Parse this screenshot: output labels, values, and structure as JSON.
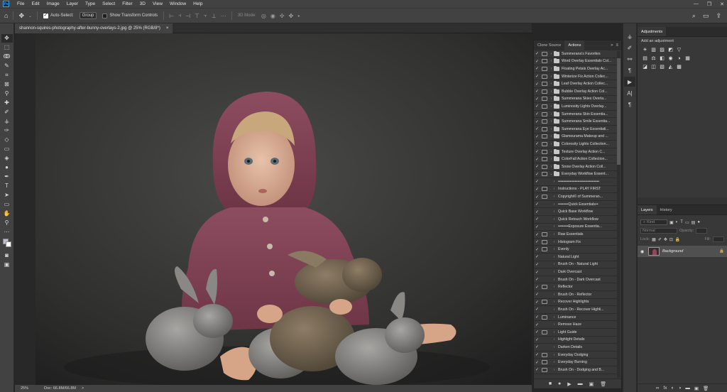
{
  "app": {
    "logo": "Ps"
  },
  "menu": [
    "File",
    "Edit",
    "Image",
    "Layer",
    "Type",
    "Select",
    "Filter",
    "3D",
    "View",
    "Window",
    "Help"
  ],
  "window_controls": {
    "minimize": "—",
    "restore": "❐",
    "close": "✕"
  },
  "options_bar": {
    "auto_select_label": "Auto-Select:",
    "auto_select_checked": true,
    "group_value": "Group",
    "show_transform_label": "Show Transform Controls",
    "mode_label": "3D Mode:"
  },
  "document": {
    "tab_title": "shannon-squires-photography-after-bunny-overlays-2.jpg @ 25% (RGB/8*)",
    "close": "×"
  },
  "status": {
    "zoom": "25%",
    "doc_info": "Doc: 66.8M/66.8M",
    "arrow": ">"
  },
  "actions_panel": {
    "tabs": [
      "Clone Source",
      "Actions"
    ],
    "active_tab": "Actions",
    "menu_icons": [
      "»",
      "≡"
    ],
    "items": [
      {
        "label": "Summerana's Favorites",
        "folder": true,
        "check": true,
        "dialog": true
      },
      {
        "label": "Word Overlay Essentials Col...",
        "folder": true,
        "check": true,
        "dialog": true
      },
      {
        "label": "Floating Petals Overlay Ac...",
        "folder": true,
        "check": true,
        "dialog": true
      },
      {
        "label": "Winterize Fix Action Collec...",
        "folder": true,
        "check": true,
        "dialog": true
      },
      {
        "label": "Leaf Overlay Action Collec...",
        "folder": true,
        "check": true,
        "dialog": true
      },
      {
        "label": "Bubble Overlay Action Col...",
        "folder": true,
        "check": true,
        "dialog": true
      },
      {
        "label": "Summerana Skies Overla...",
        "folder": true,
        "check": true,
        "dialog": true
      },
      {
        "label": "Luminosity Lights Overlay...",
        "folder": true,
        "check": true,
        "dialog": true
      },
      {
        "label": "Summerana Skin Essentia...",
        "folder": true,
        "check": true,
        "dialog": true
      },
      {
        "label": "Summerana Smile Essentia...",
        "folder": true,
        "check": true,
        "dialog": true
      },
      {
        "label": "Summerana Eye Essentiali...",
        "folder": true,
        "check": true,
        "dialog": true
      },
      {
        "label": "Glamourama Makeup and ...",
        "folder": true,
        "check": true,
        "dialog": true
      },
      {
        "label": "Colorosity Lights Collection...",
        "folder": true,
        "check": true,
        "dialog": true
      },
      {
        "label": "Texture Overlay Action C...",
        "folder": true,
        "check": true,
        "dialog": true
      },
      {
        "label": "ColorFall Action Collection...",
        "folder": true,
        "check": true,
        "dialog": true
      },
      {
        "label": "Snow Overlay Action Coll...",
        "folder": true,
        "check": true,
        "dialog": true
      },
      {
        "label": "Everyday Workflow Essent...",
        "folder": true,
        "check": true,
        "dialog": true,
        "open": true
      },
      {
        "label": "••••••••••••••••••••••••••••••••",
        "folder": false,
        "check": true,
        "dialog": false
      },
      {
        "label": "Instructions - PLAY FIRST",
        "folder": false,
        "check": true,
        "dialog": true
      },
      {
        "label": "Copyright© of Summeran...",
        "folder": false,
        "check": true,
        "dialog": true
      },
      {
        "label": "••••••••Quick Essentials••",
        "folder": false,
        "check": true,
        "dialog": false
      },
      {
        "label": "Quick Base Workflow",
        "folder": false,
        "check": true,
        "dialog": false
      },
      {
        "label": "Quick Retouch Workflow",
        "folder": false,
        "check": true,
        "dialog": false
      },
      {
        "label": "••••••••Exposure Essentia...",
        "folder": false,
        "check": true,
        "dialog": false
      },
      {
        "label": "Raw Essentials",
        "folder": false,
        "check": true,
        "dialog": true
      },
      {
        "label": "Histogram Fix",
        "folder": false,
        "check": true,
        "dialog": true
      },
      {
        "label": "Evenly",
        "folder": false,
        "check": true,
        "dialog": true
      },
      {
        "label": "Natural Light",
        "folder": false,
        "check": true,
        "dialog": false
      },
      {
        "label": "Brush On - Natural Light",
        "folder": false,
        "check": true,
        "dialog": false
      },
      {
        "label": "Dark Overcast",
        "folder": false,
        "check": true,
        "dialog": false
      },
      {
        "label": "Brush On - Dark Overcast",
        "folder": false,
        "check": true,
        "dialog": false
      },
      {
        "label": "Reflector",
        "folder": false,
        "check": true,
        "dialog": true
      },
      {
        "label": "Brush On - Reflector",
        "folder": false,
        "check": true,
        "dialog": false
      },
      {
        "label": "Recover Highlights",
        "folder": false,
        "check": true,
        "dialog": true
      },
      {
        "label": "Brush On - Recover Highli...",
        "folder": false,
        "check": true,
        "dialog": false
      },
      {
        "label": "Luminance",
        "folder": false,
        "check": true,
        "dialog": true
      },
      {
        "label": "Remove Haze",
        "folder": false,
        "check": true,
        "dialog": false
      },
      {
        "label": "Light Guide",
        "folder": false,
        "check": true,
        "dialog": true
      },
      {
        "label": "Highlight Details",
        "folder": false,
        "check": true,
        "dialog": false
      },
      {
        "label": "Darken Details",
        "folder": false,
        "check": true,
        "dialog": false
      },
      {
        "label": "Everyday Dodging",
        "folder": false,
        "check": true,
        "dialog": true
      },
      {
        "label": "Everyday Burning",
        "folder": false,
        "check": true,
        "dialog": true
      },
      {
        "label": "Brush On - Dodging and B...",
        "folder": false,
        "check": true,
        "dialog": true
      }
    ],
    "footer_icons": [
      "■",
      "●",
      "▶",
      "▬",
      "▣",
      "🗑"
    ]
  },
  "adjustments_panel": {
    "tab": "Adjustments",
    "hint": "Add an adjustment",
    "row1": [
      "☀",
      "▥",
      "▨",
      "◩",
      "▽"
    ],
    "row2": [
      "▤",
      "⚖",
      "◧",
      "◉",
      "◑",
      "▦"
    ],
    "row3": [
      "◪",
      "◫",
      "▧",
      "◭",
      "▩"
    ]
  },
  "layers_panel": {
    "tabs": [
      "Layers",
      "History"
    ],
    "active_tab": "Layers",
    "kind_label": "Kind",
    "blend_mode": "Normal",
    "opacity_label": "Opacity:",
    "fill_label": "Fill:",
    "lock_label": "Lock:",
    "layer_name": "Background",
    "footer_icons": [
      "∞",
      "fx",
      "◐",
      "◑",
      "▬",
      "▣",
      "🗑"
    ]
  }
}
